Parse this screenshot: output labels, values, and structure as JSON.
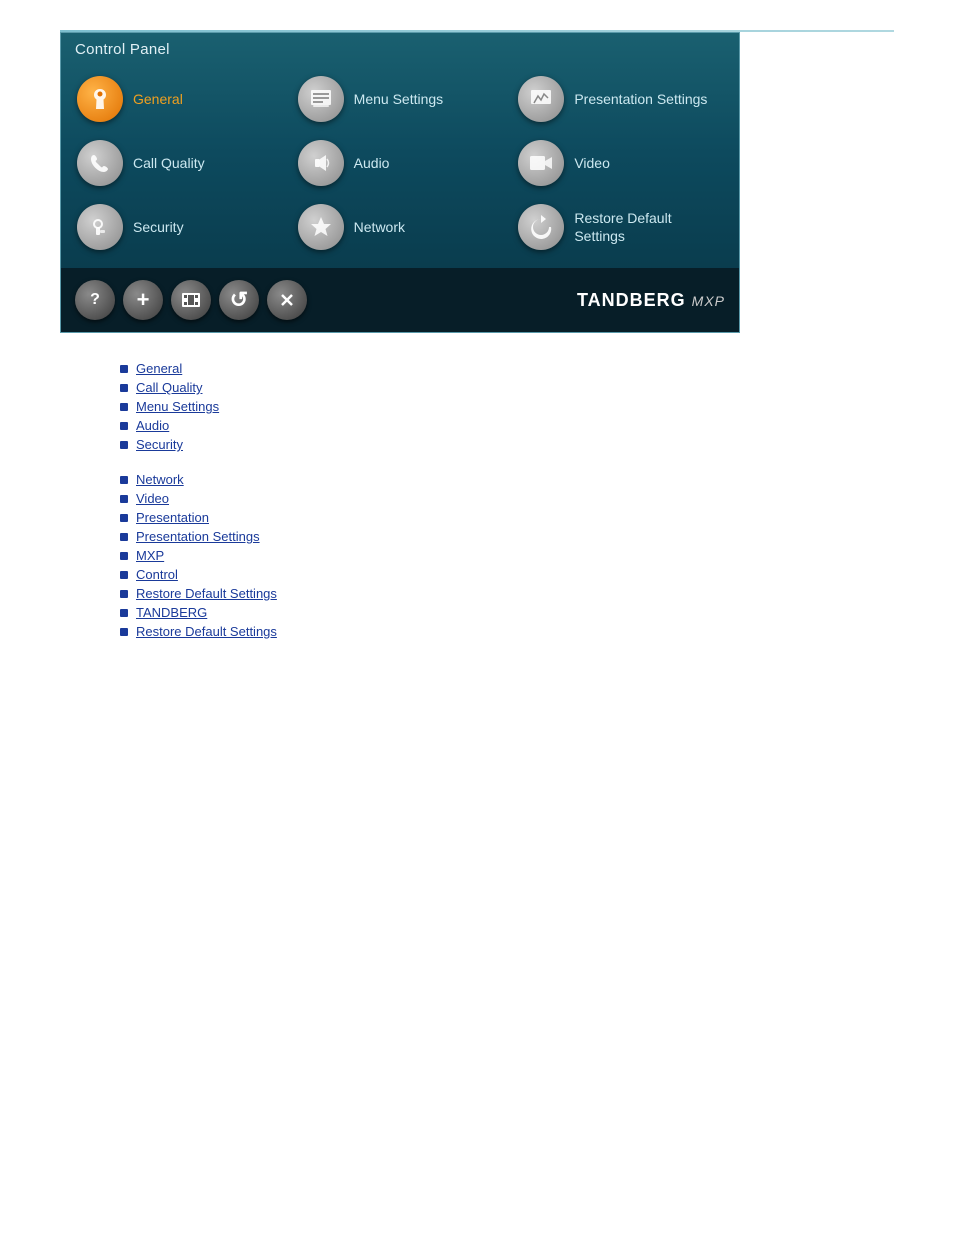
{
  "controlPanel": {
    "title": "Control Panel",
    "items": [
      {
        "id": "general",
        "label": "General",
        "icon": "wrench",
        "highlighted": true,
        "col": 0
      },
      {
        "id": "menu-settings",
        "label": "Menu Settings",
        "icon": "monitor",
        "highlighted": false,
        "col": 1
      },
      {
        "id": "presentation-settings",
        "label": "Presentation Settings",
        "icon": "chart",
        "highlighted": false,
        "col": 2
      },
      {
        "id": "call-quality",
        "label": "Call Quality",
        "icon": "call",
        "highlighted": false,
        "col": 0
      },
      {
        "id": "audio",
        "label": "Audio",
        "icon": "audio",
        "highlighted": false,
        "col": 1
      },
      {
        "id": "video",
        "label": "Video",
        "icon": "video",
        "highlighted": false,
        "col": 2
      },
      {
        "id": "security",
        "label": "Security",
        "icon": "key",
        "highlighted": false,
        "col": 0
      },
      {
        "id": "network",
        "label": "Network",
        "icon": "star",
        "highlighted": false,
        "col": 1
      },
      {
        "id": "restore-default",
        "label": "Restore Default Settings",
        "icon": "restore",
        "highlighted": false,
        "col": 2
      }
    ],
    "toolbar": {
      "buttons": [
        {
          "id": "help",
          "symbol": "?",
          "label": "help-button"
        },
        {
          "id": "add",
          "symbol": "+",
          "label": "add-button"
        },
        {
          "id": "film",
          "symbol": "▣",
          "label": "film-button"
        },
        {
          "id": "refresh",
          "symbol": "↺",
          "label": "refresh-button"
        },
        {
          "id": "close",
          "symbol": "✕",
          "label": "close-button"
        }
      ],
      "logo": "TANDBERG",
      "logoSuffix": "MXP"
    }
  },
  "linkGroups": [
    {
      "id": "group1",
      "links": [
        {
          "id": "link1",
          "text": "General"
        },
        {
          "id": "link2",
          "text": "Call Quality"
        },
        {
          "id": "link3",
          "text": "Menu Settings"
        },
        {
          "id": "link4",
          "text": "Audio"
        },
        {
          "id": "link5",
          "text": "Security"
        }
      ]
    },
    {
      "id": "group2",
      "links": [
        {
          "id": "link6",
          "text": "Network"
        },
        {
          "id": "link7",
          "text": "Video"
        },
        {
          "id": "link8",
          "text": "Presentation"
        },
        {
          "id": "link9",
          "text": "Presentation Settings"
        },
        {
          "id": "link10",
          "text": "MXP"
        },
        {
          "id": "link11",
          "text": "Control"
        },
        {
          "id": "link12",
          "text": "Restore Default Settings"
        },
        {
          "id": "link13",
          "text": "TANDBERG"
        },
        {
          "id": "link14",
          "text": "Restore Default Settings"
        }
      ]
    }
  ]
}
